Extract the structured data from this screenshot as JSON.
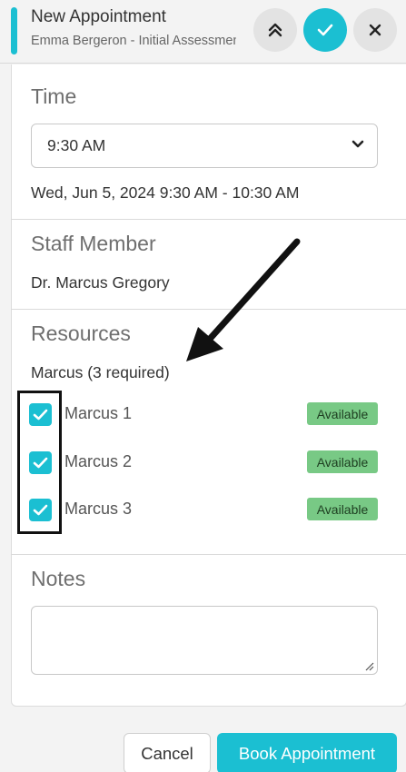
{
  "header": {
    "title": "New Appointment",
    "subtitle": "Emma Bergeron - Initial Assessment"
  },
  "time": {
    "section_title": "Time",
    "selected": "9:30 AM",
    "summary": "Wed, Jun 5, 2024 9:30 AM - 10:30 AM"
  },
  "staff": {
    "section_title": "Staff Member",
    "name": "Dr. Marcus Gregory"
  },
  "resources": {
    "section_title": "Resources",
    "requirement": "Marcus (3 required)",
    "items": [
      {
        "label": "Marcus 1",
        "checked": true,
        "status": "Available"
      },
      {
        "label": "Marcus 2",
        "checked": true,
        "status": "Available"
      },
      {
        "label": "Marcus 3",
        "checked": true,
        "status": "Available"
      }
    ]
  },
  "notes": {
    "section_title": "Notes",
    "value": ""
  },
  "footer": {
    "cancel_label": "Cancel",
    "book_label": "Book Appointment"
  },
  "colors": {
    "accent": "#1bbfd2",
    "available_badge": "#78c985",
    "annotation": "#111111"
  },
  "icons": [
    "double-chevron-up-icon",
    "check-icon",
    "close-icon",
    "chevron-down-icon",
    "checkbox-check-icon",
    "resize-grip-icon",
    "annotation-arrow"
  ]
}
